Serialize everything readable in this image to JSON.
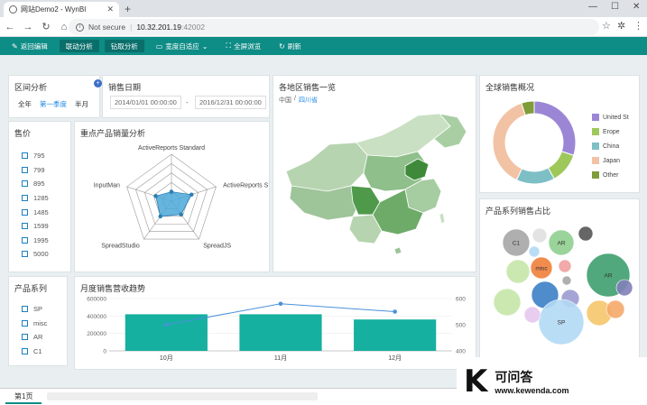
{
  "browser": {
    "tab_title": "网站Demo2 - WynBI",
    "url_secure_label": "Not secure",
    "url_host": "10.32.201.19",
    "url_port": ":42002"
  },
  "toolbar": {
    "buttons": [
      {
        "label": "返回编辑",
        "icon": "pencil-icon"
      },
      {
        "label": "联动分析",
        "icon": ""
      },
      {
        "label": "钻取分析",
        "icon": ""
      },
      {
        "label": "宽度自适应",
        "icon": "fit-width-icon"
      },
      {
        "label": "全屏浏览",
        "icon": "fullscreen-icon"
      },
      {
        "label": "刷新",
        "icon": "refresh-icon"
      }
    ]
  },
  "interval": {
    "title": "区间分析",
    "options": [
      "全年",
      "第一季度",
      "半月"
    ],
    "selected": "第一季度"
  },
  "sales_date": {
    "title": "销售日期",
    "start": "2014/01/01 00:00:00",
    "separator": "-",
    "end": "2016/12/31 00:00:00"
  },
  "price": {
    "title": "售价",
    "items": [
      "795",
      "799",
      "895",
      "1285",
      "1485",
      "1599",
      "1995",
      "5000"
    ]
  },
  "radar": {
    "title": "重点产品销量分析",
    "chart_data": {
      "type": "radar",
      "categories": [
        "ActiveReports Standard",
        "ActiveReports S",
        "SpreadJS",
        "SpreadStudio",
        "InputMan"
      ],
      "values": [
        0.2,
        0.45,
        0.35,
        0.4,
        0.35
      ],
      "color": "#4aa8d8"
    }
  },
  "region_map": {
    "title": "各地区销售一览",
    "crumb_root": "中国",
    "crumb_sep": "/",
    "crumb_current": "四川省"
  },
  "global_sales": {
    "title": "全球销售概况",
    "chart_data": {
      "type": "pie",
      "categories": [
        "United St",
        "Erope",
        "China",
        "Japan",
        "Other"
      ],
      "values": [
        30,
        12,
        15,
        38,
        5
      ],
      "colors": [
        "#9b86d6",
        "#9ec85a",
        "#7ebfc6",
        "#f2c2a4",
        "#7f9c3a"
      ]
    }
  },
  "product_series": {
    "title": "产品系列",
    "items": [
      "SP",
      "misc",
      "AR",
      "C1"
    ]
  },
  "monthly_trend": {
    "title": "月度销售营收趋势",
    "chart_data": {
      "type": "bar",
      "categories": [
        "10月",
        "11月",
        "12月"
      ],
      "bar_values": [
        420000,
        420000,
        360000
      ],
      "line_values": [
        500,
        580,
        550
      ],
      "ylim_left": [
        0,
        600000
      ],
      "yticks_left": [
        "0",
        "200000",
        "400000",
        "600000"
      ],
      "ylim_right": [
        400,
        600
      ],
      "yticks_right": [
        "400",
        "500",
        "600"
      ],
      "bar_color": "#16b0a0",
      "line_color": "#4a90d9"
    }
  },
  "bubble": {
    "title": "产品系列销售占比",
    "chart_data": {
      "type": "bubble",
      "labels": [
        "C1",
        "",
        "",
        "AR",
        "",
        "misc",
        "",
        "",
        "",
        "AR",
        "",
        "",
        "SP",
        "",
        "",
        "",
        "",
        ""
      ],
      "colors": [
        "#a6a6a6",
        "#e0e0e0",
        "#b3d9f5",
        "#8fcf8f",
        "#555555",
        "#f07f3c",
        "#c6e6a8",
        "#f0a0a0",
        "#a6a6a6",
        "#3e9e6e",
        "#3b7fc7",
        "#9b9bd0",
        "#b3d9f5",
        "#f5c56a",
        "#c6e6a8",
        "#e6c8f0",
        "#f5a96a",
        "#7f7fb8"
      ]
    }
  },
  "page_tab": "第1页",
  "watermark": {
    "letter": "K",
    "line1": "可问答",
    "line2": "www.kewenda.com"
  }
}
